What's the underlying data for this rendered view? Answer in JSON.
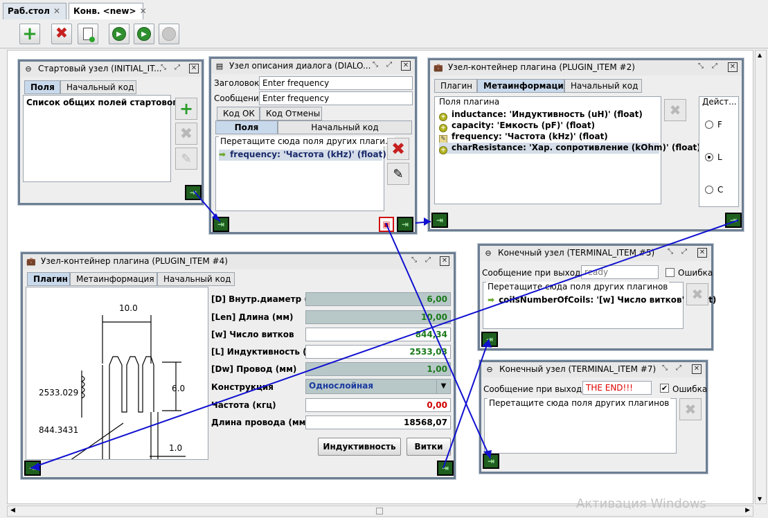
{
  "tabs": [
    {
      "label": "Раб.стол",
      "close": "✕"
    },
    {
      "label": "Конв. <new>",
      "close": "✕"
    }
  ],
  "toolbar": {
    "add": "add-icon",
    "delete": "delete-icon",
    "doc": "document-icon",
    "run": "play-icon",
    "run2": "play-step-icon",
    "stop": "stop-icon"
  },
  "initial_node": {
    "title": "Стартовый узел (INITIAL_IT...",
    "tabs": [
      "Поля",
      "Начальный код"
    ],
    "list_header": "Список общих полей стартового ..."
  },
  "dialog_node": {
    "title": "Узел описания диалога (DIALO...",
    "header_label": "Заголовок",
    "header_value": "Enter frequency",
    "message_label": "Сообщение",
    "message_value": "Enter frequency",
    "subtabs_top": [
      "Код ОК",
      "Код Отмены"
    ],
    "subtabs_bottom": [
      "Поля",
      "Начальный код"
    ],
    "group_title": "Перетащите сюда поля других плаги...",
    "item": "frequency: 'Частота (kHz)' (float)"
  },
  "plugin2_node": {
    "title": "Узел-контейнер плагина (PLUGIN_ITEM #2)",
    "tabs": [
      "Плагин",
      "Метаинформация",
      "Начальный код"
    ],
    "group_title": "Поля плагина",
    "items": [
      "inductance: 'Индуктивность (uH)' (float)",
      "capacity: 'Емкость (pF)' (float)",
      "frequency: 'Частота (kHz)' (float)",
      "charResistance: 'Хар. сопротивление (kOhm)' (float)"
    ],
    "actions_title": "Дейст...",
    "radio": [
      "F",
      "L",
      "C"
    ],
    "radio_selected": "L"
  },
  "plugin4_node": {
    "title": "Узел-контейнер плагина (PLUGIN_ITEM #4)",
    "tabs": [
      "Плагин",
      "Метаинформация",
      "Начальный код"
    ],
    "diagram": {
      "d1": "10.0",
      "d2": "2533.029",
      "d3": "6.0",
      "d4": "1.0",
      "d5": "844.3431"
    },
    "rows": [
      {
        "label": "[D] Внутр.диаметр (мм)",
        "value": "6,00"
      },
      {
        "label": "[Len] Длина (мм)",
        "value": "10,00"
      },
      {
        "label": "[w] Число витков",
        "value": "844,34"
      },
      {
        "label": "[L] Индуктивность (uH)",
        "value": "2533,03"
      },
      {
        "label": "[Dw] Провод (мм)",
        "value": "1,00"
      },
      {
        "label": "Конструкция",
        "value": "Однослойная"
      },
      {
        "label": "Частота (кгц)",
        "value": "0,00"
      },
      {
        "label": "Длина провода (мм)",
        "value": "18568,07"
      }
    ],
    "buttons": [
      "Индуктивность",
      "Витки"
    ]
  },
  "terminal5_node": {
    "title": "Конечный узел (TERMINAL_ITEM #5)",
    "message_label": "Сообщение при выходе",
    "message_value": "ready",
    "error_label": "Ошибка",
    "error_checked": false,
    "group_title": "Перетащите сюда поля других плагинов",
    "item": "coilsNumberOfCoils: '[w] Число витков' (float)"
  },
  "terminal7_node": {
    "title": "Конечный узел (TERMINAL_ITEM #7)",
    "message_label": "Сообщение при выходе",
    "message_value": "THE END!!!",
    "error_label": "Ошибка",
    "error_checked": true,
    "group_title": "Перетащите сюда поля других плагинов"
  },
  "watermark": "Активация Windows",
  "colors": {
    "wire": "#1010d0",
    "accent_green": "#2a9d2a",
    "danger": "#c62020"
  }
}
